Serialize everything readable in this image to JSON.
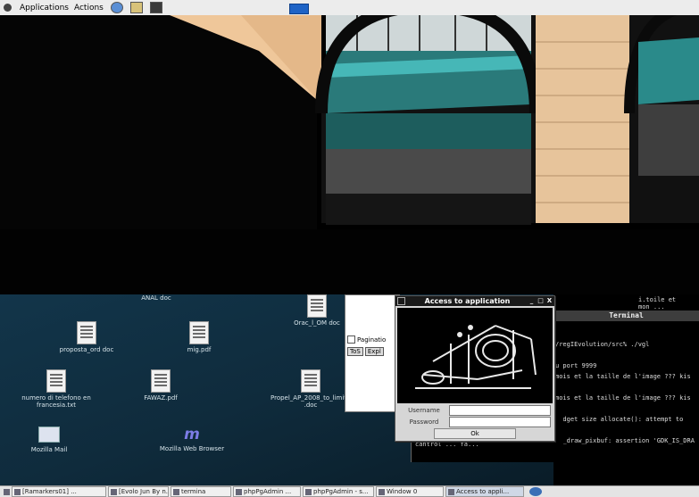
{
  "top_panel": {
    "menus": [
      "Applications",
      "Actions"
    ],
    "launchers": [
      "help-icon",
      "notes-icon",
      "terminal-icon"
    ]
  },
  "desktop_icons": [
    {
      "name": "ANAL.doc",
      "label": "ANAL doc"
    },
    {
      "name": "Oracle-doc",
      "label": "Orac_l_OM doc"
    },
    {
      "name": "proposta-doc",
      "label": "proposta_ord doc"
    },
    {
      "name": "mig-pdf",
      "label": "mig.pdf"
    },
    {
      "name": "numero-telefono",
      "label": "numero di telefono en francesia.txt"
    },
    {
      "name": "FAW-pdf",
      "label": "FAWAZ.pdf"
    },
    {
      "name": "progetto-doc",
      "label": "Propel_AP_2008_to_limits_vs_ldc_0.52_15P .doc"
    },
    {
      "name": "mozilla-mail",
      "label": "Mozilla Mail"
    },
    {
      "name": "mozilla-browser",
      "label": "Mozilla Web Browser"
    }
  ],
  "bg_window": {
    "checkbox_label": "Paginatio",
    "button1": "ToS",
    "button2": "Expl"
  },
  "terminal": {
    "title": "Terminal",
    "top_lines": [
      "i.toile et",
      "mon ..."
    ],
    "lines": [
      "/regIEvolution/src% ./vgl",
      "",
      "u port 9999",
      "mois et la taille de l'image ??? kis",
      "",
      "mois et la taille de l'image ??? kis",
      "",
      "widget size allocate(): attempt to",
      "",
      "dk_draw_pixbuf: assertion 'GDK_IS_DRA"
    ],
    "under_line": "cantrol ... fa..."
  },
  "dialog": {
    "title": "Access to application",
    "controls": [
      "_",
      "□",
      "X"
    ],
    "username_label": "Username",
    "username_value": "",
    "password_label": "Password",
    "password_value": "",
    "ok_label": "Ok"
  },
  "taskbar": {
    "items": [
      "[Ramarkers01] ...",
      "[Evolo Jun By n...",
      "termina",
      "phpPgAdmin ...",
      "phpPgAdmin - s...",
      "Window 0",
      "Access to appli..."
    ]
  }
}
